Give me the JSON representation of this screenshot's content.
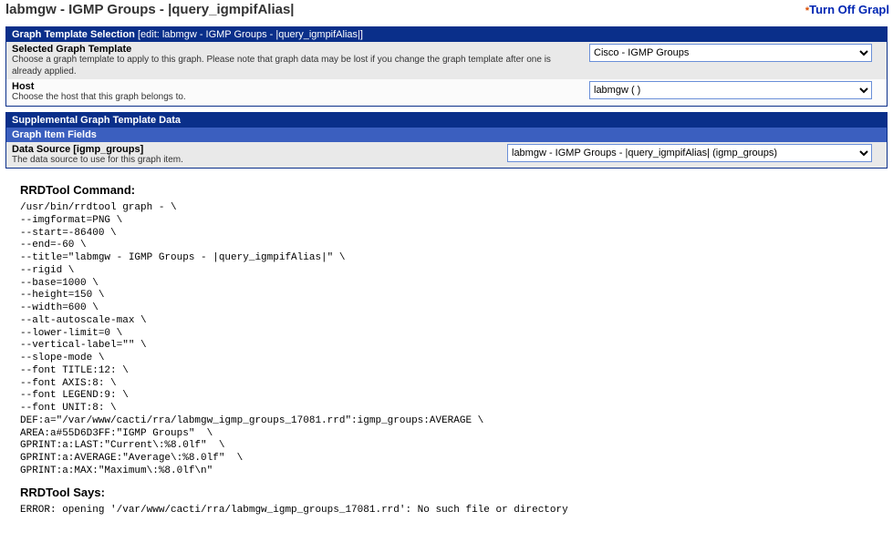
{
  "page": {
    "title": "labmgw - IGMP Groups - |query_igmpifAlias|",
    "turn_off_label": "Turn Off Grapl"
  },
  "selection_panel": {
    "header": "Graph Template Selection",
    "edit_label": "[edit: labmgw - IGMP Groups - |query_igmpifAlias|]",
    "template_field": {
      "label": "Selected Graph Template",
      "desc": "Choose a graph template to apply to this graph. Please note that graph data may be lost if you change the graph template after one is already applied.",
      "value": "Cisco - IGMP Groups"
    },
    "host_field": {
      "label": "Host",
      "desc": "Choose the host that this graph belongs to.",
      "value": "labmgw (                         )"
    }
  },
  "supplemental_panel": {
    "header": "Supplemental Graph Template Data",
    "subheader": "Graph Item Fields",
    "ds_field": {
      "label": "Data Source [igmp_groups]",
      "desc": "The data source to use for this graph item.",
      "value": "labmgw - IGMP Groups - |query_igmpifAlias| (igmp_groups)"
    }
  },
  "rrd": {
    "cmd_title": "RRDTool Command:",
    "cmd_text": "/usr/bin/rrdtool graph - \\\n--imgformat=PNG \\\n--start=-86400 \\\n--end=-60 \\\n--title=\"labmgw - IGMP Groups - |query_igmpifAlias|\" \\\n--rigid \\\n--base=1000 \\\n--height=150 \\\n--width=600 \\\n--alt-autoscale-max \\\n--lower-limit=0 \\\n--vertical-label=\"\" \\\n--slope-mode \\\n--font TITLE:12: \\\n--font AXIS:8: \\\n--font LEGEND:9: \\\n--font UNIT:8: \\\nDEF:a=\"/var/www/cacti/rra/labmgw_igmp_groups_17081.rrd\":igmp_groups:AVERAGE \\\nAREA:a#55D6D3FF:\"IGMP Groups\"  \\\nGPRINT:a:LAST:\"Current\\:%8.0lf\"  \\\nGPRINT:a:AVERAGE:\"Average\\:%8.0lf\"  \\\nGPRINT:a:MAX:\"Maximum\\:%8.0lf\\n\"",
    "says_title": "RRDTool Says:",
    "says_text": "ERROR: opening '/var/www/cacti/rra/labmgw_igmp_groups_17081.rrd': No such file or directory"
  }
}
